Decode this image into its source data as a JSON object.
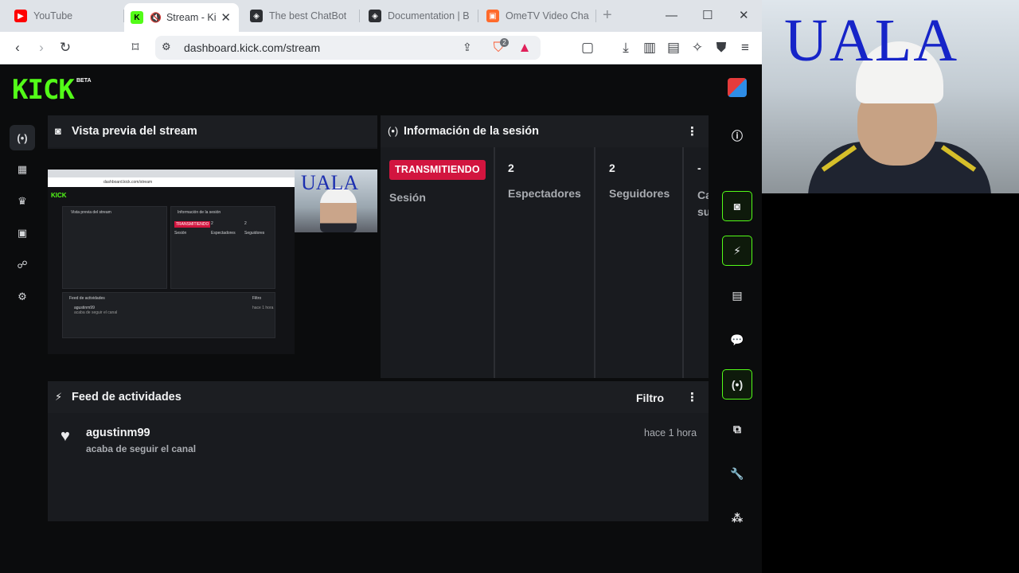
{
  "browser": {
    "tabs": [
      {
        "label": "YouTube",
        "icon": "youtube-icon"
      },
      {
        "label": "Stream - Ki",
        "icon": "kick-icon",
        "muted": true
      },
      {
        "label": "The best ChatBot",
        "icon": "chatbot-icon"
      },
      {
        "label": "Documentation | B",
        "icon": "docs-icon"
      },
      {
        "label": "OmeTV Video Cha",
        "icon": "ometv-icon"
      }
    ],
    "new_tab": "+",
    "url": "dashboard.kick.com/stream",
    "shield_badge": "2"
  },
  "dashboard": {
    "logo": "KICK",
    "logo_badge": "BETA",
    "preview": {
      "title": "Vista previa del stream",
      "camera_text": "UALA"
    },
    "session": {
      "title": "Información de la sesión",
      "status": "TRANSMITIENDO",
      "status_label": "Sesión",
      "stats": [
        {
          "value": "2",
          "label": "Espectadores"
        },
        {
          "value": "2",
          "label": "Seguidores"
        },
        {
          "value": "-",
          "label": "Ca su"
        }
      ]
    },
    "activity": {
      "title": "Feed de actividades",
      "filter_label": "Filtro",
      "items": [
        {
          "user": "agustinm99",
          "desc": "acaba de seguir el canal",
          "time": "hace 1 hora"
        }
      ]
    },
    "mini": {
      "preview_title": "Vista previa del stream",
      "session_title": "Información de la sesión",
      "status": "TRANSMITIENDO",
      "status_label": "Sesión",
      "viewers": "2",
      "viewers_label": "Espectadores",
      "followers": "2",
      "followers_label": "Seguidores",
      "activity_title": "Feed de actividades",
      "filter": "Filtro",
      "user": "agustinm99",
      "desc": "acaba de seguir el canal",
      "time": "hace 1 hora",
      "url": "dashboard.kick.com/stream"
    }
  },
  "webcam": {
    "text": "UALA"
  },
  "colors": {
    "kick_green": "#53fc18",
    "live_red": "#d2153f",
    "panel": "#191b1f"
  }
}
